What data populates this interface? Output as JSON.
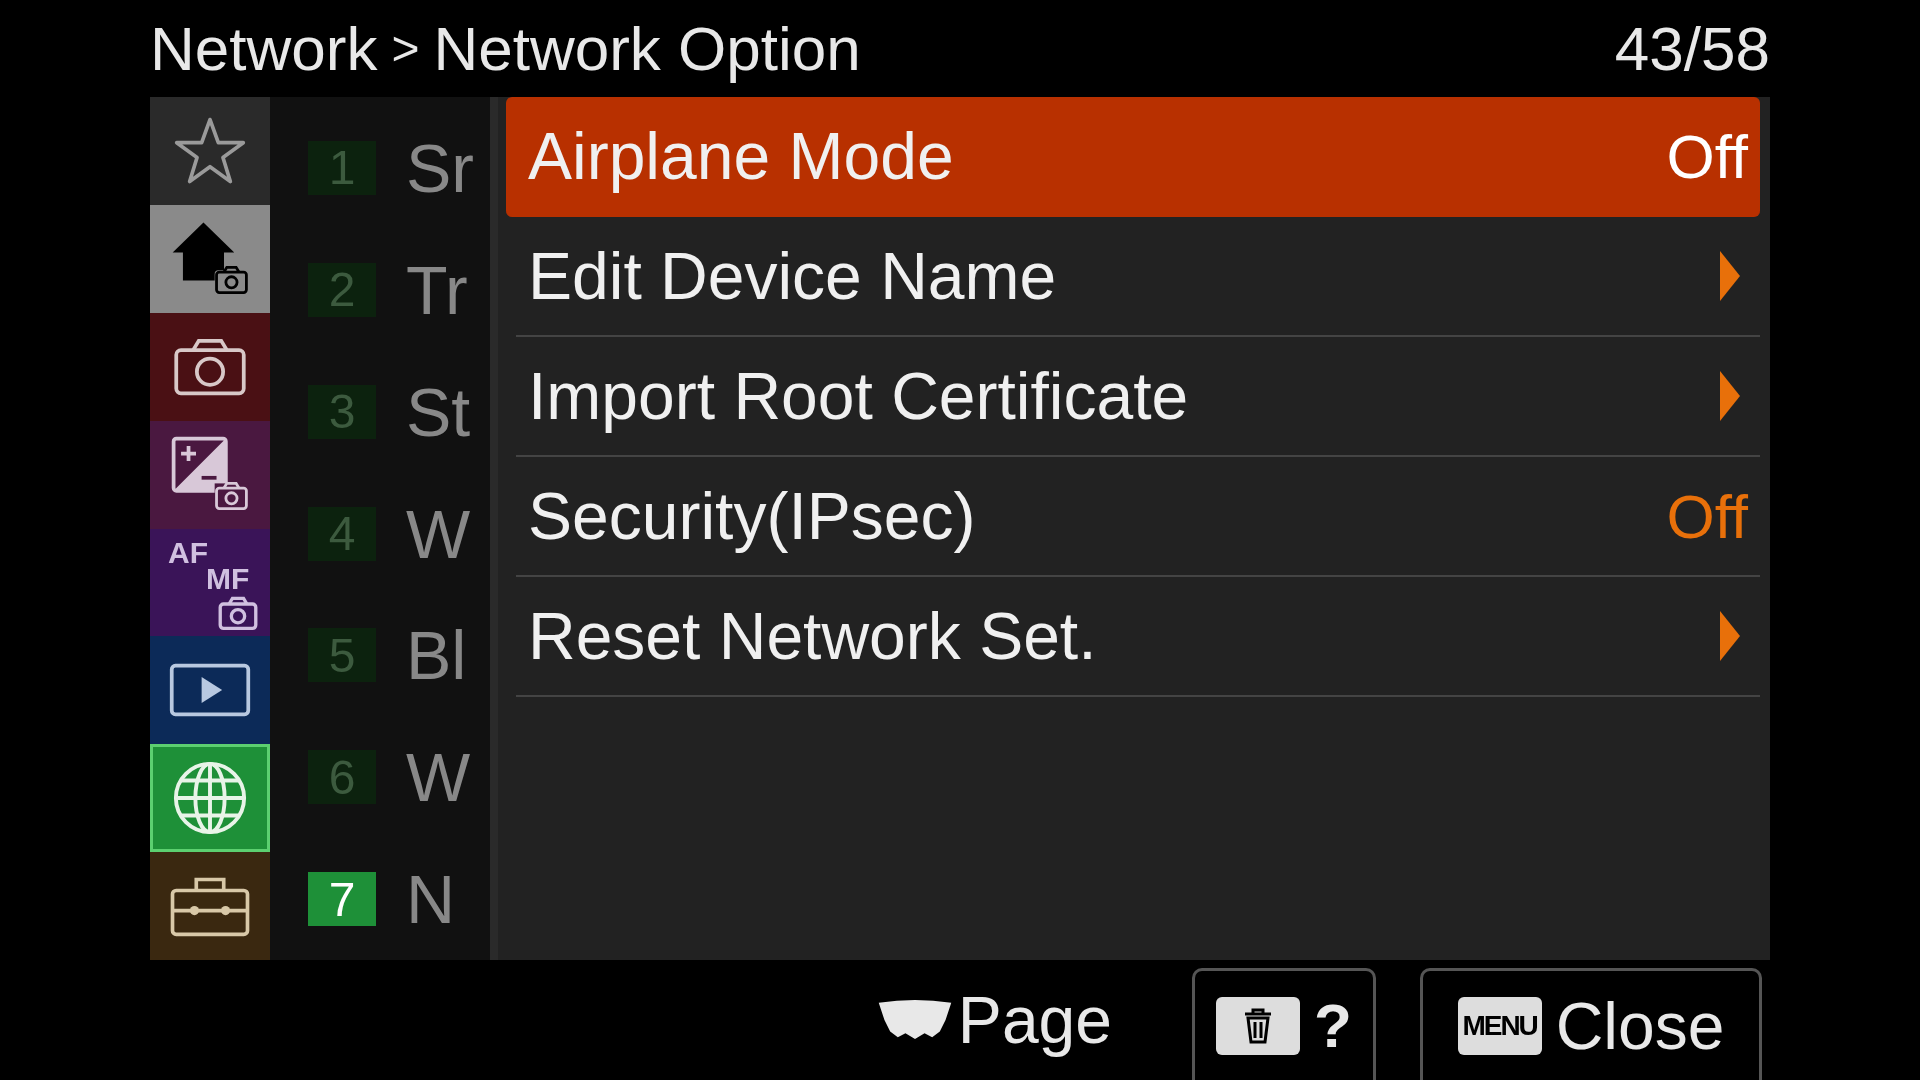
{
  "header": {
    "breadcrumb": "Network",
    "separator": ">",
    "title": "Network Option",
    "page_counter": "43/58"
  },
  "tabs": [
    {
      "kind": "star",
      "color": "#2a2a2a",
      "selected": false
    },
    {
      "kind": "home",
      "color": "#8a8a8a",
      "selected": false
    },
    {
      "kind": "camera",
      "color": "#4a1014",
      "selected": false
    },
    {
      "kind": "exposure",
      "color": "#4a1840",
      "selected": false
    },
    {
      "kind": "focus",
      "label_top": "AF",
      "label_bottom": "MF",
      "color": "#3a1458",
      "selected": false
    },
    {
      "kind": "playback",
      "color": "#0c2a58",
      "selected": false
    },
    {
      "kind": "network",
      "color": "#1e9038",
      "selected": true
    },
    {
      "kind": "setup",
      "color": "#3a2810",
      "selected": false
    }
  ],
  "sections": [
    {
      "number": "1",
      "label": "Sr",
      "selected": false
    },
    {
      "number": "2",
      "label": "Tr",
      "selected": false
    },
    {
      "number": "3",
      "label": "St",
      "selected": false
    },
    {
      "number": "4",
      "label": "W",
      "selected": false
    },
    {
      "number": "5",
      "label": "Bl",
      "selected": false
    },
    {
      "number": "6",
      "label": "W",
      "selected": false
    },
    {
      "number": "7",
      "label": "N",
      "selected": true
    }
  ],
  "menu_items": [
    {
      "label": "Airplane Mode",
      "kind": "value",
      "value": "Off",
      "selected": true
    },
    {
      "label": "Edit Device Name",
      "kind": "submenu",
      "selected": false
    },
    {
      "label": "Import Root Certificate",
      "kind": "submenu",
      "selected": false
    },
    {
      "label": "Security(IPsec)",
      "kind": "value",
      "value": "Off",
      "selected": false
    },
    {
      "label": "Reset Network Set.",
      "kind": "submenu",
      "selected": false
    }
  ],
  "footer": {
    "page_label": "Page",
    "help_label": "?",
    "menu_key": "MENU",
    "close_label": "Close"
  }
}
